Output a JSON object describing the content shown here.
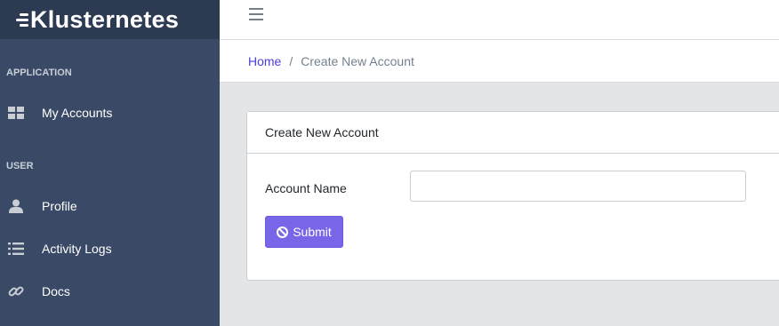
{
  "brand": {
    "name": "Klusternetes"
  },
  "sidebar": {
    "sections": [
      {
        "title": "APPLICATION",
        "items": [
          {
            "label": "My Accounts",
            "icon": "grid-icon"
          }
        ]
      },
      {
        "title": "USER",
        "items": [
          {
            "label": "Profile",
            "icon": "user-icon"
          },
          {
            "label": "Activity Logs",
            "icon": "list-icon"
          },
          {
            "label": "Docs",
            "icon": "link-icon"
          }
        ]
      }
    ]
  },
  "header": {
    "menu_icon": "hamburger-icon"
  },
  "breadcrumb": {
    "home": "Home",
    "separator": "/",
    "current": "Create New Account"
  },
  "card": {
    "title": "Create New Account",
    "account_name_label": "Account Name",
    "account_name_value": "",
    "account_name_placeholder": "",
    "submit_label": "Submit",
    "submit_icon": "ban-icon"
  },
  "colors": {
    "sidebar": "#3a4a66",
    "brand_bar": "#2c3a52",
    "accent": "#7766e8",
    "link": "#4a3ee0",
    "background": "#e4e5e6"
  }
}
